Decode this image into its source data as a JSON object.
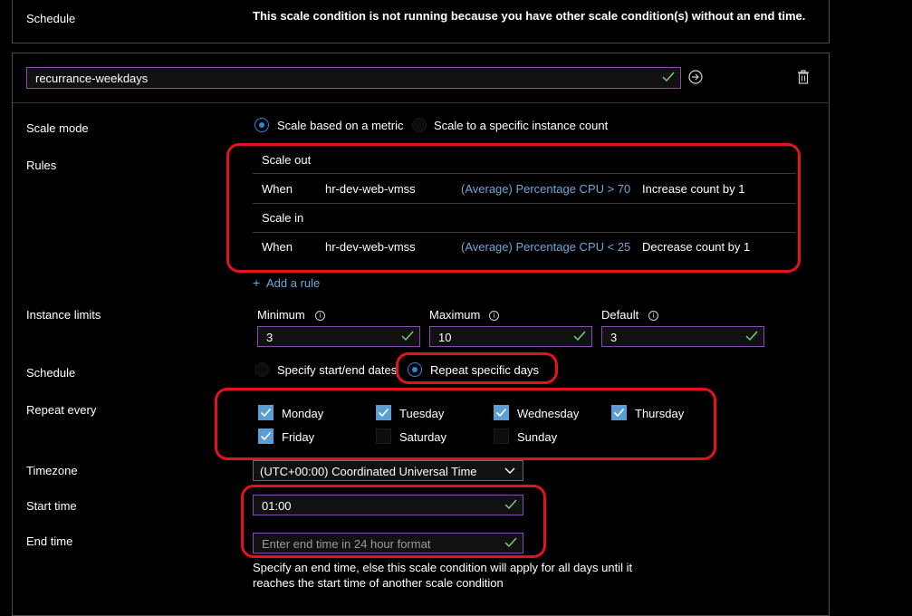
{
  "schedule_banner": {
    "label": "Schedule",
    "message": "This scale condition is not running because you have other scale condition(s) without an end time."
  },
  "condition": {
    "name_value": "recurrance-weekdays",
    "go_icon": "arrow-right-circle-icon",
    "delete_icon": "trash-icon"
  },
  "scale_mode": {
    "label": "Scale mode",
    "option_metric": "Scale based on a metric",
    "option_count": "Scale to a specific instance count",
    "selected": "metric"
  },
  "rules": {
    "label": "Rules",
    "scale_out_header": "Scale out",
    "scale_in_header": "Scale in",
    "out_rule": {
      "when": "When",
      "resource": "hr-dev-web-vmss",
      "metric": "(Average) Percentage CPU > 70",
      "action": "Increase count by 1"
    },
    "in_rule": {
      "when": "When",
      "resource": "hr-dev-web-vmss",
      "metric": "(Average) Percentage CPU < 25",
      "action": "Decrease count by 1"
    },
    "add_rule": "Add a rule"
  },
  "instance_limits": {
    "label": "Instance limits",
    "minimum_label": "Minimum",
    "maximum_label": "Maximum",
    "default_label": "Default",
    "minimum": "3",
    "maximum": "10",
    "default": "3"
  },
  "schedule": {
    "label": "Schedule",
    "option_dates": "Specify start/end dates",
    "option_days": "Repeat specific days",
    "selected": "days"
  },
  "repeat": {
    "label": "Repeat every",
    "days": [
      {
        "name": "Monday",
        "checked": true
      },
      {
        "name": "Tuesday",
        "checked": true
      },
      {
        "name": "Wednesday",
        "checked": true
      },
      {
        "name": "Thursday",
        "checked": true
      },
      {
        "name": "Friday",
        "checked": true
      },
      {
        "name": "Saturday",
        "checked": false
      },
      {
        "name": "Sunday",
        "checked": false
      }
    ]
  },
  "timezone": {
    "label": "Timezone",
    "value": "(UTC+00:00) Coordinated Universal Time"
  },
  "start_time": {
    "label": "Start time",
    "value": "01:00"
  },
  "end_time": {
    "label": "End time",
    "placeholder": "Enter end time in 24 hour format",
    "hint_line1": "Specify an end time, else this scale condition will apply for all days until it",
    "hint_line2": "reaches the start time of another scale condition"
  },
  "colors": {
    "accent": "#2b88d8",
    "highlight": "#e1141e",
    "input_border": "#8a4ab3",
    "link": "#6ea6d8",
    "check": "#5a9ed6"
  }
}
